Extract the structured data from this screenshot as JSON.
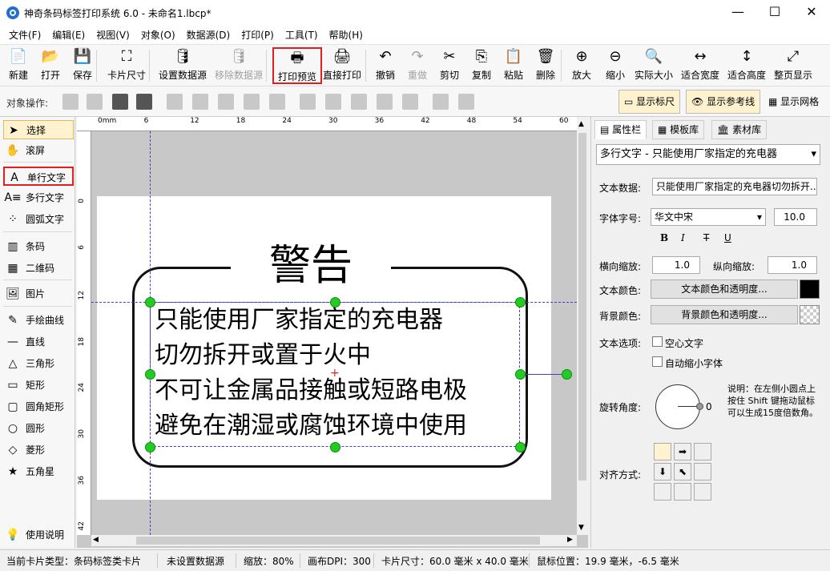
{
  "window": {
    "title": "神奇条码标签打印系统 6.0 - 未命名1.lbcp*",
    "minimize": "—",
    "maximize": "☐",
    "close": "✕"
  },
  "menu": [
    "文件(F)",
    "编辑(E)",
    "视图(V)",
    "对象(O)",
    "数据源(D)",
    "打印(P)",
    "工具(T)",
    "帮助(H)"
  ],
  "toolbar": [
    {
      "label": "新建",
      "icon": "new-file-icon",
      "glyph": "📄"
    },
    {
      "label": "打开",
      "icon": "open-icon",
      "glyph": "📂"
    },
    {
      "label": "保存",
      "icon": "save-icon",
      "glyph": "💾"
    },
    {
      "label": "卡片尺寸",
      "icon": "card-size-icon",
      "glyph": "⛶"
    },
    {
      "label": "设置数据源",
      "icon": "database-icon",
      "glyph": "🛢"
    },
    {
      "label": "移除数据源",
      "icon": "remove-database-icon",
      "glyph": "🛢",
      "disabled": true
    },
    {
      "label": "打印预览",
      "icon": "print-preview-icon",
      "glyph": "🖶",
      "highlighted": true
    },
    {
      "label": "直接打印",
      "icon": "print-icon",
      "glyph": "🖨"
    },
    {
      "label": "撤销",
      "icon": "undo-icon",
      "glyph": "↶"
    },
    {
      "label": "重做",
      "icon": "redo-icon",
      "glyph": "↷",
      "disabled": true
    },
    {
      "label": "剪切",
      "icon": "cut-icon",
      "glyph": "✂"
    },
    {
      "label": "复制",
      "icon": "copy-icon",
      "glyph": "⎘"
    },
    {
      "label": "粘贴",
      "icon": "paste-icon",
      "glyph": "📋"
    },
    {
      "label": "删除",
      "icon": "delete-icon",
      "glyph": "🗑"
    },
    {
      "label": "放大",
      "icon": "zoom-in-icon",
      "glyph": "⊕"
    },
    {
      "label": "缩小",
      "icon": "zoom-out-icon",
      "glyph": "⊖"
    },
    {
      "label": "实际大小",
      "icon": "actual-size-icon",
      "glyph": "🔍"
    },
    {
      "label": "适合宽度",
      "icon": "fit-width-icon",
      "glyph": "↔"
    },
    {
      "label": "适合高度",
      "icon": "fit-height-icon",
      "glyph": "↕"
    },
    {
      "label": "整页显示",
      "icon": "fit-page-icon",
      "glyph": "⤢"
    }
  ],
  "object_bar": {
    "label": "对象操作:",
    "show_ruler": "显示标尺",
    "show_guides": "显示参考线",
    "show_grid": "显示网格"
  },
  "tools": [
    {
      "label": "选择",
      "icon": "pointer-icon",
      "glyph": "➤",
      "selected": true
    },
    {
      "label": "滚屏",
      "icon": "hand-icon",
      "glyph": "✋"
    },
    {
      "label": "单行文字",
      "icon": "single-line-text-icon",
      "glyph": "A",
      "boxed": true
    },
    {
      "label": "多行文字",
      "icon": "multi-line-text-icon",
      "glyph": "A≡"
    },
    {
      "label": "圆弧文字",
      "icon": "arc-text-icon",
      "glyph": "⁘"
    },
    {
      "label": "条码",
      "icon": "barcode-icon",
      "glyph": "▥"
    },
    {
      "label": "二维码",
      "icon": "qrcode-icon",
      "glyph": "▦"
    },
    {
      "label": "图片",
      "icon": "image-icon",
      "glyph": "🖼"
    },
    {
      "label": "手绘曲线",
      "icon": "pen-icon",
      "glyph": "✎"
    },
    {
      "label": "直线",
      "icon": "line-icon",
      "glyph": "—"
    },
    {
      "label": "三角形",
      "icon": "triangle-icon",
      "glyph": "△"
    },
    {
      "label": "矩形",
      "icon": "rectangle-icon",
      "glyph": "▭"
    },
    {
      "label": "圆角矩形",
      "icon": "rounded-rectangle-icon",
      "glyph": "▢"
    },
    {
      "label": "圆形",
      "icon": "circle-icon",
      "glyph": "○"
    },
    {
      "label": "菱形",
      "icon": "diamond-icon",
      "glyph": "◇"
    },
    {
      "label": "五角星",
      "icon": "star-icon",
      "glyph": "★"
    },
    {
      "label": "使用说明",
      "icon": "lightbulb-icon",
      "glyph": "💡"
    }
  ],
  "ruler": {
    "h_labels": [
      "0mm",
      "6",
      "12",
      "18",
      "24",
      "30",
      "36",
      "42",
      "48",
      "54",
      "60"
    ],
    "v_labels": [
      "0",
      "6",
      "12",
      "18",
      "24",
      "30",
      "36",
      "42"
    ]
  },
  "label": {
    "title": "警告",
    "lines": [
      "只能使用厂家指定的充电器",
      "切勿拆开或置于火中",
      "不可让金属品接触或短路电极",
      "避免在潮湿或腐蚀环境中使用"
    ]
  },
  "properties": {
    "tabs": [
      "属性栏",
      "模板库",
      "素材库"
    ],
    "object_select": "多行文字 - 只能使用厂家指定的充电器",
    "text_data_label": "文本数据:",
    "text_data_value": "只能使用厂家指定的充电器切勿拆开...",
    "font_label": "字体字号:",
    "font_value": "华文中宋",
    "font_size": "10.0",
    "bold": "B",
    "italic": "I",
    "strike": "T",
    "underline": "U",
    "hscale_label": "横向缩放:",
    "hscale_value": "1.0",
    "vscale_label": "纵向缩放:",
    "vscale_value": "1.0",
    "text_color_label": "文本颜色:",
    "text_color_button": "文本颜色和透明度...",
    "text_color": "#000000",
    "bg_color_label": "背景颜色:",
    "bg_color_button": "背景颜色和透明度...",
    "options_label": "文本选项:",
    "hollow_text": "空心文字",
    "auto_shrink": "自动缩小字体",
    "rotation_label": "旋转角度:",
    "rotation_value": "0",
    "rotation_hint": "说明：在左侧小圆点上按住 Shift 键拖动鼠标可以生成15度倍数角。",
    "align_label": "对齐方式:"
  },
  "status": {
    "card_type": "当前卡片类型：条码标签类卡片",
    "datasource": "未设置数据源",
    "zoom": "缩放：80%",
    "dpi": "画布DPI：300",
    "card_size": "卡片尺寸：60.0 毫米 x 40.0 毫米",
    "mouse_pos": "鼠标位置：19.9 毫米，-6.5 毫米"
  },
  "colors": {
    "accent": "#1e6fd0",
    "highlight": "#e02020",
    "handle": "#22cc22",
    "selected_bg": "#fff3cf"
  }
}
